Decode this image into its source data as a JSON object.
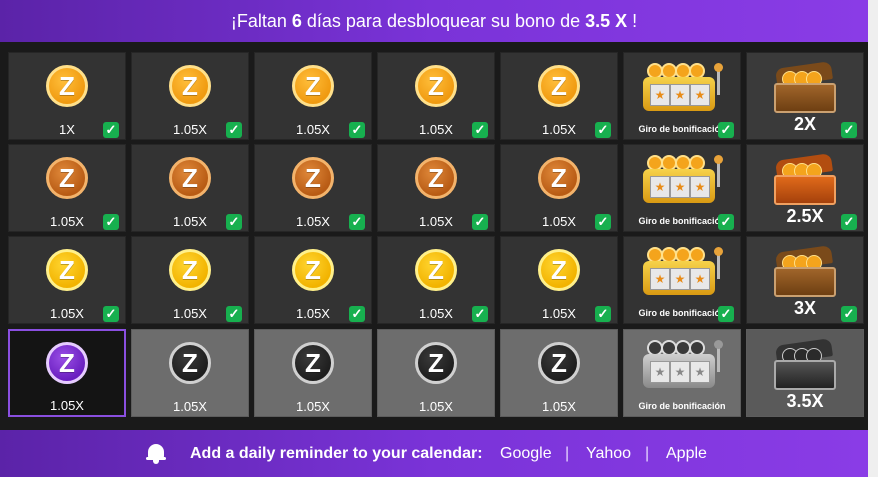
{
  "header": {
    "prefix": "¡Faltan ",
    "days": "6",
    "middle": " días para desbloquear su bono de ",
    "bonus": "3.5 X",
    "suffix": " !"
  },
  "tiles": {
    "r0": [
      "1X",
      "1.05X",
      "1.05X",
      "1.05X",
      "1.05X"
    ],
    "r1": [
      "1.05X",
      "1.05X",
      "1.05X",
      "1.05X",
      "1.05X"
    ],
    "r2": [
      "1.05X",
      "1.05X",
      "1.05X",
      "1.05X",
      "1.05X"
    ],
    "r3": [
      "1.05X",
      "1.05X",
      "1.05X",
      "1.05X",
      "1.05X"
    ]
  },
  "slot_label": "Giro de bonificación",
  "big": [
    "2X",
    "2.5X",
    "3X",
    "3.5X"
  ],
  "coin_symbol": "Z",
  "check_symbol": "✓",
  "star_symbol": "★",
  "colors": {
    "purple": "#7a33d8",
    "check_green": "#17b04f",
    "gold": "#f09a10",
    "bronze": "#b85b14",
    "yellow": "#f2b300"
  },
  "footer": {
    "reminder": "Add a daily reminder to your calendar:",
    "google": "Google",
    "yahoo": "Yahoo",
    "apple": "Apple",
    "sep": "|"
  }
}
